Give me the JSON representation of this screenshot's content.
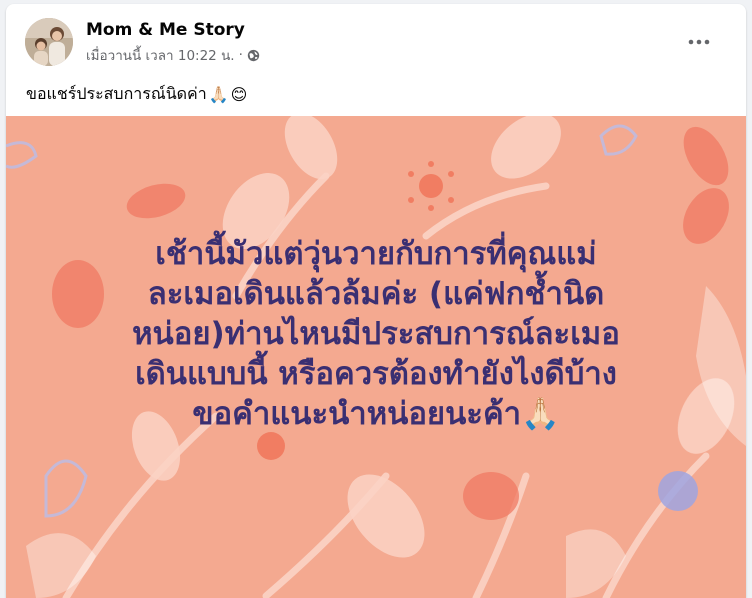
{
  "post": {
    "author_name": "Mom & Me Story",
    "timestamp": "เมื่อวานนี้ เวลา 10:22 น.",
    "separator": "·",
    "privacy_icon": "globe-icon",
    "more_icon": "more-options-icon",
    "caption": "ขอแชร์ประสบการณ์นิดค่า",
    "caption_emojis": [
      "🙏🏻",
      "😊"
    ],
    "image_text": "เช้านี้มัวแต่วุ่นวายกับการที่คุณแม่\nละเมอเดินแล้วล้มค่ะ (แค่ฟกช้ำนิด\nหน่อย)ท่านไหนมีประสบการณ์ละเมอ\nเดินแบบนี้ หรือควรต้องทำยังไงดีบ้าง\nขอคำแนะนำหน่อยนะค้า🙏🏻",
    "image_bg_color": "#f4a990",
    "image_text_color": "#3a2f72"
  }
}
